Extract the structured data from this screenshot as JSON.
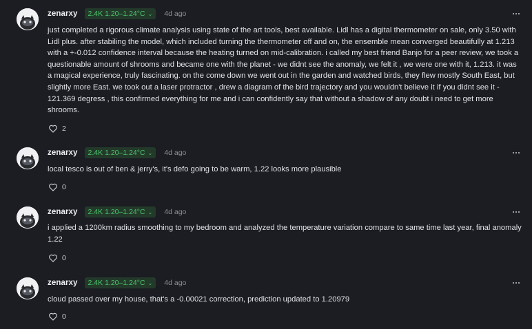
{
  "comments": [
    {
      "user": "zenarxy",
      "flair": "2.4K 1.20–1.24°C",
      "time": "4d ago",
      "text": "just completed a rigorous climate analysis using state of the art tools, best available. Lidl has a digital thermometer on sale, only 3.50 with Lidl plus. after stabiling the model, which included turning the thermometer off and on, the ensemble mean converged beautifully at 1.213 with a +-0.012 confidence interval because the heating turned on mid-calibration. i called my best friend Banjo for a peer review, we took a questionable amount of shrooms and became one with the planet - we didnt see the anomaly, we felt it , we were one with it, 1.213. it was a magical experience, truly fascinating. on the come down we went out in the garden and watched birds, they flew mostly South East, but slightly more East. we took out a laser protractor , drew a diagram of the bird trajectory and you wouldn't believe it if you didnt see it - 121.369 degress , this confirmed everything for me and i can confidently say that without a shadow of any doubt i need to get more shrooms.",
      "likes": "2"
    },
    {
      "user": "zenarxy",
      "flair": "2.4K 1.20–1.24°C",
      "time": "4d ago",
      "text": "local tesco is out of ben & jerry's, it's defo going to be warm, 1.22 looks more plausible",
      "likes": "0"
    },
    {
      "user": "zenarxy",
      "flair": "2.4K 1.20–1.24°C",
      "time": "4d ago",
      "text": "i applied a 1200km radius smoothing to my bedroom and analyzed the temperature variation compare to same time last year, final anomaly 1.22",
      "likes": "0"
    },
    {
      "user": "zenarxy",
      "flair": "2.4K 1.20–1.24°C",
      "time": "4d ago",
      "text": "cloud passed over my house, that's a -0.00021 correction, prediction updated to 1.20979",
      "likes": "0"
    }
  ],
  "colors": {
    "background": "#1b1d22",
    "flair_text": "#4cc36a",
    "flair_bg": "#233a2a",
    "meta": "#8c9199"
  },
  "icons": {
    "avatar": "raccoon-avatar",
    "more": "more-horizontal-icon",
    "like": "heart-icon",
    "flair_dropdown": "chevron-down-icon"
  }
}
